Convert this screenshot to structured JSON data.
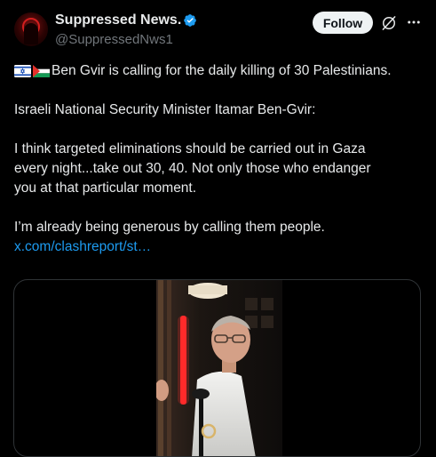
{
  "author": {
    "display_name": "Suppressed News.",
    "handle": "@SuppressedNws1",
    "verified": true,
    "avatar_icon": "hooded-figure-avatar"
  },
  "actions": {
    "follow_label": "Follow",
    "grok_icon": "grok-icon",
    "more_icon": "more-icon"
  },
  "tweet": {
    "flags": [
      "israel-flag-icon",
      "palestine-flag-icon"
    ],
    "line1": "Ben Gvir is calling for the daily killing of 30 Palestinians.",
    "line2": "Israeli National Security Minister Itamar Ben-Gvir:",
    "line3a": "I think targeted eliminations should be carried out in Gaza",
    "line3b": "every night...take out 30, 40. Not only those who endanger",
    "line3c": "you at that particular moment.",
    "line4": "I’m already being generous by calling them people.",
    "link": "x.com/clashreport/st…"
  },
  "colors": {
    "background": "#000000",
    "text": "#e7e9ea",
    "secondary_text": "#71767b",
    "link": "#1d9bf0",
    "verified_badge": "#1d9bf0",
    "follow_button_bg": "#eff3f4",
    "media_border": "#2f3336"
  }
}
